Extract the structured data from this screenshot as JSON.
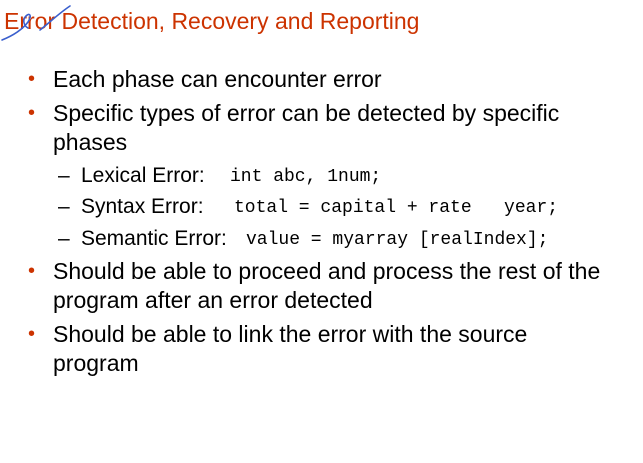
{
  "slide": {
    "title": "Error Detection, Recovery and Reporting",
    "bullets": [
      "Each phase can encounter error",
      "Specific types of error can be detected by specific",
      "phases",
      "Should be able to proceed and process the rest of the",
      "program after an error detected",
      "Should be able to link the error with the source",
      "program"
    ],
    "sub_items": [
      {
        "dash": "–",
        "label": "Lexical Error:",
        "code": "int abc, 1num;"
      },
      {
        "dash": "–",
        "label": "Syntax Error:",
        "code": "total = capital + rate   year;"
      },
      {
        "dash": "–",
        "label": "Semantic Error:",
        "code": "value = myarray [realIndex];"
      }
    ],
    "bullet_symbol": "•",
    "colors": {
      "title": "#cc3300",
      "bullet": "#cc3300",
      "ink": "#3a5fcd"
    }
  }
}
